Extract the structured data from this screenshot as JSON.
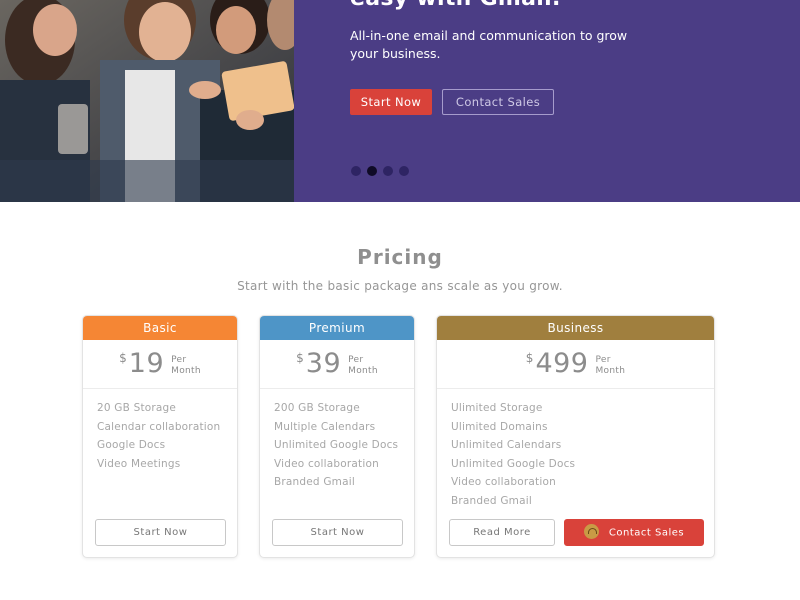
{
  "hero": {
    "headline": "easy with Gmail.",
    "subtitle": "All-in-one email and communication to grow your business.",
    "start_label": "Start Now",
    "contact_label": "Contact Sales",
    "carousel_dots": 4,
    "carousel_active": 1,
    "background_color": "#4b3d85"
  },
  "pricing": {
    "title": "Pricing",
    "subtitle": "Start with the basic package ans scale as you grow.",
    "plans": [
      {
        "name": "Basic",
        "color": "#f58634",
        "currency": "$",
        "price": "19",
        "per_line1": "Per",
        "per_line2": "Month",
        "features": [
          "20 GB Storage",
          "Calendar collaboration",
          "Google Docs",
          "Video Meetings"
        ],
        "button": "Start Now"
      },
      {
        "name": "Premium",
        "color": "#4e95c7",
        "currency": "$",
        "price": "39",
        "per_line1": "Per",
        "per_line2": "Month",
        "features": [
          "200 GB Storage",
          "Multiple Calendars",
          "Unlimited Google Docs",
          "Video collaboration",
          "Branded Gmail"
        ],
        "button": "Start Now"
      },
      {
        "name": "Business",
        "color": "#a07f3e",
        "currency": "$",
        "price": "499",
        "per_line1": "Per",
        "per_line2": "Month",
        "features": [
          "Ulimited Storage",
          "Ulimited Domains",
          "Unlimited Calendars",
          "Unlimited Google Docs",
          "Video collaboration",
          "Branded Gmail"
        ],
        "button": "Read More",
        "button2": "Contact Sales",
        "button2_icon": "support-headset-icon"
      }
    ]
  }
}
